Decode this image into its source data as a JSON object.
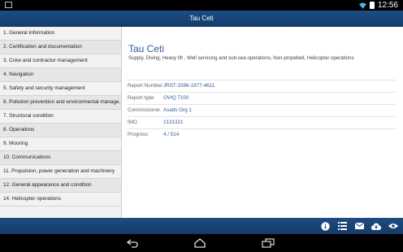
{
  "status": {
    "time": "12:56"
  },
  "header": {
    "title": "Tau Ceti"
  },
  "sidebar": {
    "items": [
      "1. General information",
      "2. Certification and documentation",
      "3. Crew and contractor management",
      "4. Navigation",
      "5. Safety and security management",
      "6. Pollution prevention and environmental manage…",
      "7. Structural condition",
      "8. Operations",
      "9. Mooring",
      "10. Communications",
      "11. Propulsion, power generation and machinery",
      "12. General appearance and condition",
      "14. Helicopter operations"
    ]
  },
  "report": {
    "title": "Tau Ceti",
    "subtitle": "Supply, Diving, Heavy lift , Well servicing and sub-sea operations, Non-propelled, Helicopter operations",
    "fields": [
      {
        "label": "Report Number",
        "value": "JRST-1596-1977-4611"
      },
      {
        "label": "Report type",
        "value": "OVIQ 7100"
      },
      {
        "label": "Commissioner",
        "value": "Asads Org 1"
      },
      {
        "label": "IMO",
        "value": "2131321"
      },
      {
        "label": "Progress",
        "value": "4 / 514"
      }
    ]
  },
  "toolbar": {
    "icons": [
      "info-icon",
      "list-icon",
      "mail-icon",
      "upload-icon",
      "eye-icon"
    ]
  },
  "colors": {
    "header": "#1c4d85",
    "accent": "#2d5c9c"
  }
}
